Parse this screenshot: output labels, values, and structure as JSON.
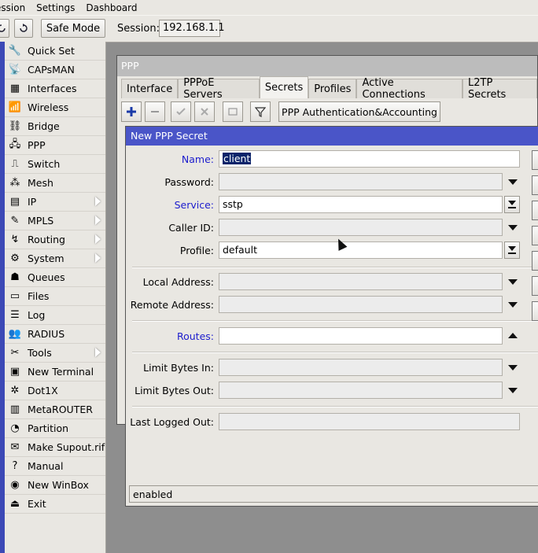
{
  "menubar": {
    "items": [
      "ession",
      "Settings",
      "Dashboard"
    ]
  },
  "toolbar": {
    "safe_mode": "Safe Mode",
    "session_label": "Session:",
    "session_value": "192.168.1.1"
  },
  "sidebar": {
    "items": [
      {
        "label": "Quick Set",
        "icon": "quick-set-icon",
        "arrow": false
      },
      {
        "label": "CAPsMAN",
        "icon": "capsman-icon",
        "arrow": false
      },
      {
        "label": "Interfaces",
        "icon": "interfaces-icon",
        "arrow": false
      },
      {
        "label": "Wireless",
        "icon": "wireless-icon",
        "arrow": false
      },
      {
        "label": "Bridge",
        "icon": "bridge-icon",
        "arrow": false
      },
      {
        "label": "PPP",
        "icon": "ppp-icon",
        "arrow": false
      },
      {
        "label": "Switch",
        "icon": "switch-icon",
        "arrow": false
      },
      {
        "label": "Mesh",
        "icon": "mesh-icon",
        "arrow": false
      },
      {
        "label": "IP",
        "icon": "ip-icon",
        "arrow": true
      },
      {
        "label": "MPLS",
        "icon": "mpls-icon",
        "arrow": true
      },
      {
        "label": "Routing",
        "icon": "routing-icon",
        "arrow": true
      },
      {
        "label": "System",
        "icon": "system-icon",
        "arrow": true
      },
      {
        "label": "Queues",
        "icon": "queues-icon",
        "arrow": false
      },
      {
        "label": "Files",
        "icon": "files-icon",
        "arrow": false
      },
      {
        "label": "Log",
        "icon": "log-icon",
        "arrow": false
      },
      {
        "label": "RADIUS",
        "icon": "radius-icon",
        "arrow": false
      },
      {
        "label": "Tools",
        "icon": "tools-icon",
        "arrow": true
      },
      {
        "label": "New Terminal",
        "icon": "terminal-icon",
        "arrow": false
      },
      {
        "label": "Dot1X",
        "icon": "dot1x-icon",
        "arrow": false
      },
      {
        "label": "MetaROUTER",
        "icon": "metarouter-icon",
        "arrow": false
      },
      {
        "label": "Partition",
        "icon": "partition-icon",
        "arrow": false
      },
      {
        "label": "Make Supout.rif",
        "icon": "supout-icon",
        "arrow": false
      },
      {
        "label": "Manual",
        "icon": "manual-icon",
        "arrow": false
      },
      {
        "label": "New WinBox",
        "icon": "winbox-icon",
        "arrow": false
      },
      {
        "label": "Exit",
        "icon": "exit-icon",
        "arrow": false
      }
    ]
  },
  "ppp_window": {
    "title": "PPP",
    "tabs": [
      "Interface",
      "PPPoE Servers",
      "Secrets",
      "Profiles",
      "Active Connections",
      "L2TP Secrets"
    ],
    "active_tab": "Secrets",
    "auth_button": "PPP Authentication&Accounting"
  },
  "dialog": {
    "title": "New PPP Secret",
    "fields": {
      "name": {
        "label": "Name:",
        "value": "client"
      },
      "password": {
        "label": "Password:",
        "value": ""
      },
      "service": {
        "label": "Service:",
        "value": "sstp"
      },
      "caller_id": {
        "label": "Caller ID:",
        "value": ""
      },
      "profile": {
        "label": "Profile:",
        "value": "default"
      },
      "local_address": {
        "label": "Local Address:",
        "value": ""
      },
      "remote_address": {
        "label": "Remote Address:",
        "value": ""
      },
      "routes": {
        "label": "Routes:",
        "value": ""
      },
      "limit_in": {
        "label": "Limit Bytes In:",
        "value": ""
      },
      "limit_out": {
        "label": "Limit Bytes Out:",
        "value": ""
      },
      "last_logged_out": {
        "label": "Last Logged Out:",
        "value": ""
      }
    },
    "status": "enabled"
  },
  "colors": {
    "sidebar_strip": "#3c49b6",
    "dialog_title": "#4a55c8",
    "blue_label": "#1c1ccd"
  }
}
